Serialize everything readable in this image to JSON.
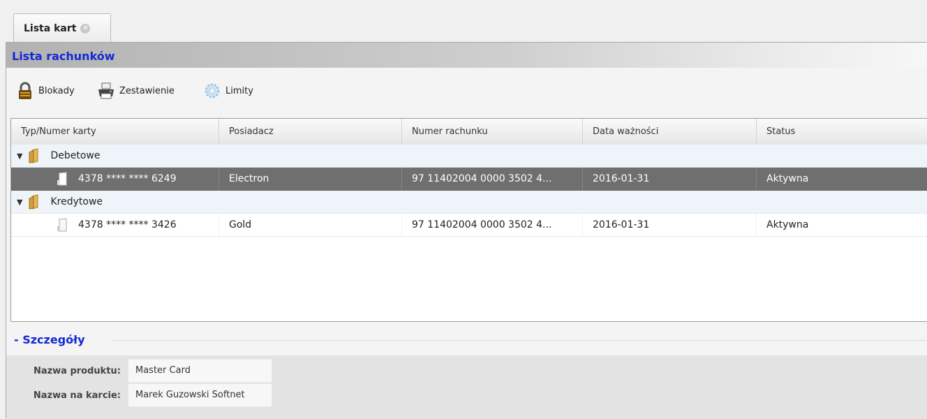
{
  "tab": {
    "label": "Lista kart"
  },
  "panel": {
    "title": "Lista rachunków"
  },
  "toolbar": {
    "blokady": "Blokady",
    "zestawienie": "Zestawienie",
    "limity": "Limity"
  },
  "grid": {
    "columns": [
      "Typ/Numer karty",
      "Posiadacz",
      "Numer rachunku",
      "Data ważności",
      "Status"
    ],
    "groups": [
      {
        "label": "Debetowe",
        "rows": [
          {
            "card": "4378 **** **** 6249",
            "holder": "Electron",
            "account": "97 11402004 0000 3502 4...",
            "expiry": "2016-01-31",
            "status": "Aktywna"
          }
        ]
      },
      {
        "label": "Kredytowe",
        "rows": [
          {
            "card": "4378 **** **** 3426",
            "holder": "Gold",
            "account": "97 11402004 0000 3502 4...",
            "expiry": "2016-01-31",
            "status": "Aktywna"
          }
        ]
      }
    ]
  },
  "details": {
    "title": "- Szczegóły",
    "fields": [
      {
        "label": "Nazwa produktu:",
        "value": "Master Card"
      },
      {
        "label": "Nazwa na karcie:",
        "value": "Marek Guzowski Softnet"
      }
    ]
  }
}
